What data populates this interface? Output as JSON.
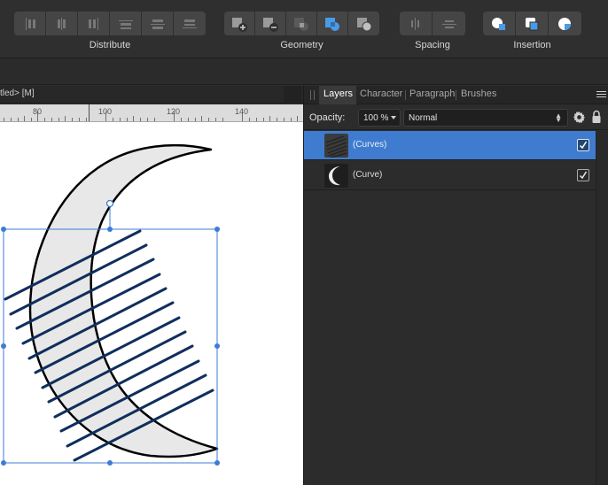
{
  "toolbar": {
    "groups": [
      {
        "id": "distribute",
        "label": "Distribute"
      },
      {
        "id": "geometry",
        "label": "Geometry"
      },
      {
        "id": "spacing",
        "label": "Spacing"
      },
      {
        "id": "insertion",
        "label": "Insertion"
      }
    ]
  },
  "document": {
    "tab_label": "tled> [M]",
    "ruler_ticks": [
      "80",
      "100",
      "120",
      "140"
    ]
  },
  "panel": {
    "tabs": [
      "Layers",
      "Character",
      "Paragraph",
      "Brushes"
    ],
    "active_tab": "Layers",
    "opacity_label": "Opacity:",
    "opacity_value": "100 %",
    "blend_mode": "Normal",
    "layers": [
      {
        "name": "(Curves)",
        "selected": true,
        "visible": true
      },
      {
        "name": "(Curve)",
        "selected": false,
        "visible": true
      }
    ]
  },
  "colors": {
    "selection_blue": "#3f7ccf",
    "handle_blue": "#3d7bd6",
    "hatch_line": "#0f2f5c",
    "moon_fill": "#e8e8e8",
    "icon_accent": "#4a9be6"
  }
}
